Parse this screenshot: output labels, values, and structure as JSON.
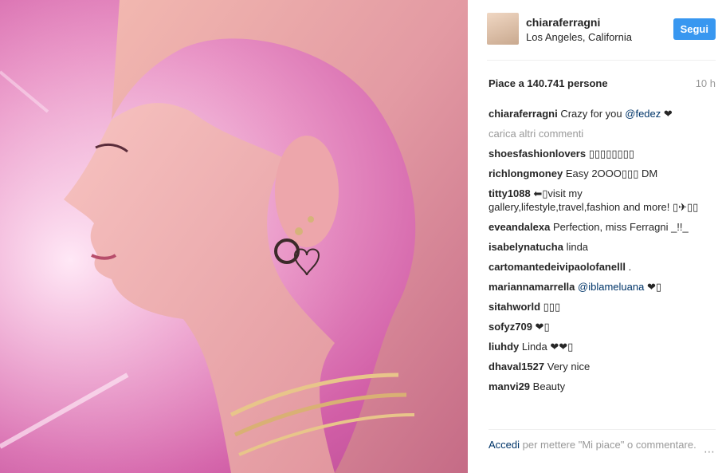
{
  "post": {
    "username": "chiaraferragni",
    "location": "Los Angeles, California",
    "follow_label": "Segui",
    "likes_text": "Piace a 140.741 persone",
    "time_ago": "10 h"
  },
  "caption": {
    "user": "chiaraferragni",
    "text": "Crazy for you",
    "mention": "@fedez",
    "suffix": " ❤"
  },
  "load_more_label": "carica altri commenti",
  "comments": [
    {
      "user": "shoesfashionlovers",
      "text": "▯▯▯▯▯▯▯▯"
    },
    {
      "user": "richlongmoney",
      "text": "Easy 2OOO▯▯▯ DM"
    },
    {
      "user": "titty1088",
      "text": "⬅▯visit my gallery,lifestyle,travel,fashion and more! ▯✈▯▯"
    },
    {
      "user": "eveandalexa",
      "text": "Perfection, miss Ferragni _!!_"
    },
    {
      "user": "isabelynatucha",
      "text": "linda"
    },
    {
      "user": "cartomantedeivipaolofanelll",
      "text": "."
    },
    {
      "user": "mariannamarrella",
      "mention": "@iblameluana",
      "text": " ❤▯"
    },
    {
      "user": "sitahworld",
      "text": "▯▯▯"
    },
    {
      "user": "sofyz709",
      "text": "❤▯"
    },
    {
      "user": "liuhdy",
      "text": "Linda ❤❤▯"
    },
    {
      "user": "dhaval1527",
      "text": "Very nice"
    },
    {
      "user": "manvi29",
      "text": "Beauty"
    }
  ],
  "footer": {
    "login_label": "Accedi",
    "rest_text": " per mettere \"Mi piace\" o commentare.",
    "more_icon": "⋯"
  },
  "colors": {
    "accent": "#3897f0",
    "link": "#003569",
    "muted": "#999999",
    "photo_pink": "#e27fbb"
  }
}
